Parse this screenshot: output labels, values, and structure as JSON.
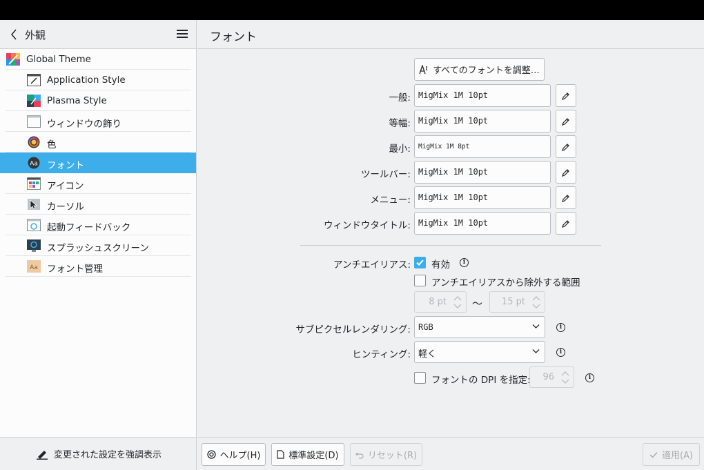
{
  "sidebar": {
    "title": "外観",
    "items": [
      {
        "label": "Global Theme",
        "icon": "global-theme-icon"
      },
      {
        "label": "Application Style",
        "icon": "application-style-icon"
      },
      {
        "label": "Plasma Style",
        "icon": "plasma-style-icon"
      },
      {
        "label": "ウィンドウの飾り",
        "icon": "window-decoration-icon"
      },
      {
        "label": "色",
        "icon": "color-icon"
      },
      {
        "label": "フォント",
        "icon": "font-icon"
      },
      {
        "label": "アイコン",
        "icon": "icons-icon"
      },
      {
        "label": "カーソル",
        "icon": "cursor-icon"
      },
      {
        "label": "起動フィードバック",
        "icon": "launch-feedback-icon"
      },
      {
        "label": "スプラッシュスクリーン",
        "icon": "splash-screen-icon"
      },
      {
        "label": "フォント管理",
        "icon": "font-management-icon"
      }
    ],
    "selected_index": 5,
    "highlight_changed_label": "変更された設定を強調表示"
  },
  "page": {
    "title": "フォント",
    "adjust_all_label": "すべてのフォントを調整…",
    "fonts": [
      {
        "label": "一般:",
        "value": "MigMix 1M 10pt"
      },
      {
        "label": "等幅:",
        "value": "MigMix 1M 10pt"
      },
      {
        "label": "最小:",
        "value": "MigMix 1M 8pt"
      },
      {
        "label": "ツールバー:",
        "value": "MigMix 1M 10pt"
      },
      {
        "label": "メニュー:",
        "value": "MigMix 1M 10pt"
      },
      {
        "label": "ウィンドウタイトル:",
        "value": "MigMix 1M 10pt"
      }
    ],
    "antialias": {
      "label": "アンチエイリアス:",
      "checkbox_label": "有効",
      "checked": true,
      "exclude_label": "アンチエイリアスから除外する範囲",
      "exclude_checked": false,
      "range_from": "8 pt",
      "range_sep": "～",
      "range_to": "15 pt"
    },
    "subpixel": {
      "label": "サブピクセルレンダリング:",
      "value": "RGB"
    },
    "hinting": {
      "label": "ヒンティング:",
      "value": "軽く"
    },
    "dpi": {
      "checkbox_label": "フォントの DPI を指定:",
      "checked": false,
      "value": "96"
    }
  },
  "buttons": {
    "help": "ヘルプ(H)",
    "defaults": "標準設定(D)",
    "reset": "リセット(R)",
    "apply": "適用(A)"
  },
  "colors": {
    "accent": "#3daee9",
    "background": "#eff0f1",
    "text": "#232629"
  }
}
